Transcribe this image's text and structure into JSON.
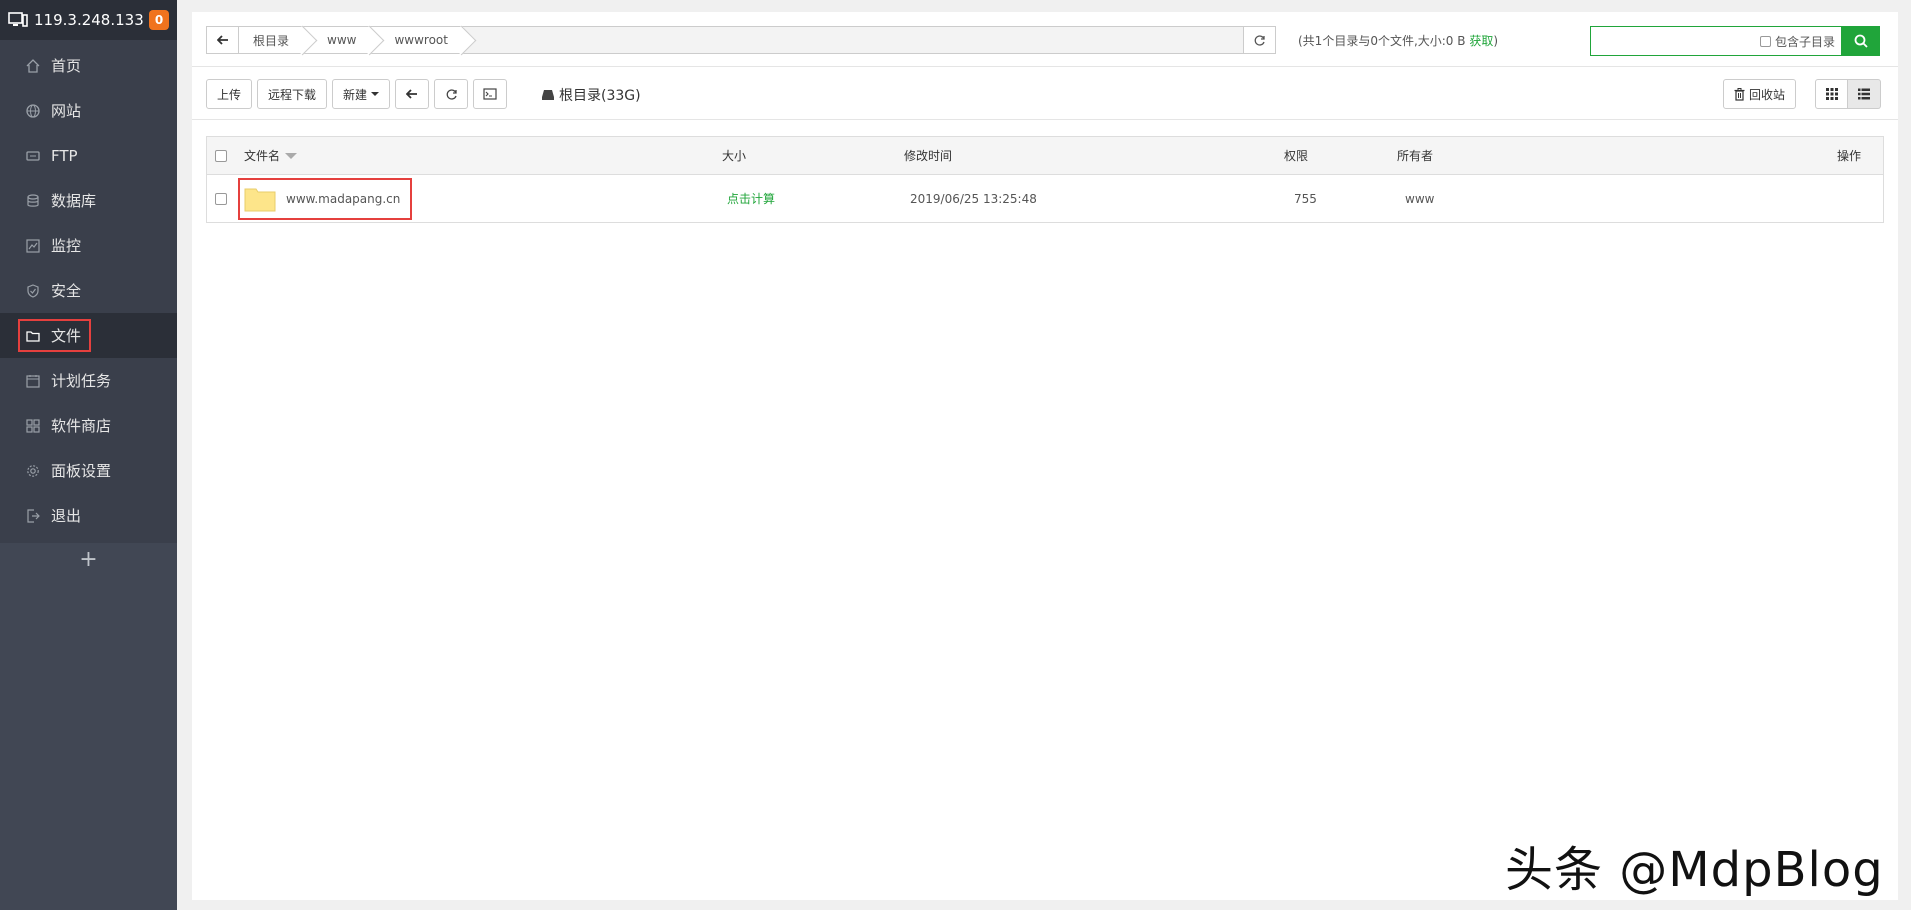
{
  "sidebar": {
    "server_ip": "119.3.248.133",
    "badge_count": "0",
    "items": [
      {
        "label": "首页",
        "icon": "home-icon"
      },
      {
        "label": "网站",
        "icon": "globe-icon"
      },
      {
        "label": "FTP",
        "icon": "ftp-icon"
      },
      {
        "label": "数据库",
        "icon": "database-icon"
      },
      {
        "label": "监控",
        "icon": "monitor-icon"
      },
      {
        "label": "安全",
        "icon": "shield-icon"
      },
      {
        "label": "文件",
        "icon": "folder-icon"
      },
      {
        "label": "计划任务",
        "icon": "calendar-icon"
      },
      {
        "label": "软件商店",
        "icon": "grid-icon"
      },
      {
        "label": "面板设置",
        "icon": "gear-icon"
      },
      {
        "label": "退出",
        "icon": "logout-icon"
      }
    ],
    "add_label": "+"
  },
  "path": {
    "crumbs": [
      "根目录",
      "www",
      "wwwroot"
    ],
    "info_text": "(共1个目录与0个文件,大小:0 B",
    "info_link": "获取",
    "info_close": ")"
  },
  "search": {
    "placeholder": "",
    "include_sub_label": "包含子目录"
  },
  "toolbar": {
    "upload": "上传",
    "remote_download": "远程下载",
    "new": "新建",
    "disk_label": "根目录(33G)",
    "recycle": "回收站"
  },
  "table": {
    "headers": {
      "name": "文件名",
      "size": "大小",
      "mtime": "修改时间",
      "perm": "权限",
      "owner": "所有者",
      "ops": "操作"
    },
    "rows": [
      {
        "name": "www.madapang.cn",
        "size": "点击计算",
        "mtime": "2019/06/25 13:25:48",
        "perm": "755",
        "owner": "www"
      }
    ]
  },
  "watermark": "头条 @MdpBlog",
  "colors": {
    "accent": "#20a53a",
    "sidebar_bg": "#3a3f4b",
    "highlight": "#e5403e",
    "badge": "#f0731e"
  }
}
